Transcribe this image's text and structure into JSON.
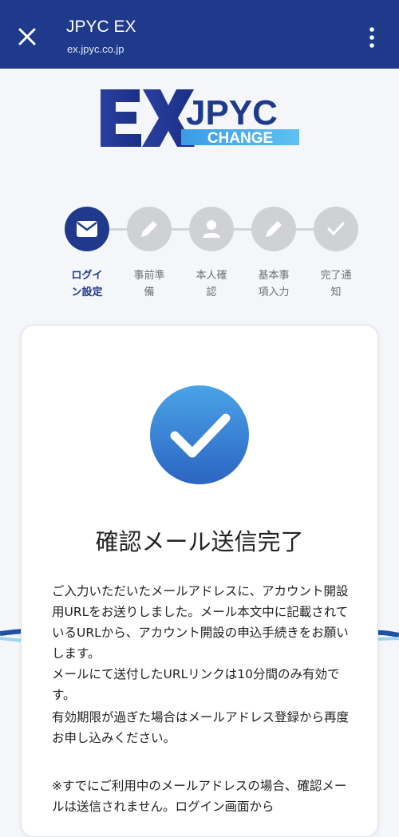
{
  "header": {
    "title": "JPYC EX",
    "url": "ex.jpyc.co.jp"
  },
  "logo": {
    "ex_text": "EX",
    "jpyc_text": "JPYC",
    "change_text": "CHANGE"
  },
  "steps": [
    {
      "label": "ログイン設定",
      "icon": "mail-icon",
      "active": true
    },
    {
      "label": "事前準備",
      "icon": "pencil-icon",
      "active": false
    },
    {
      "label": "本人確認",
      "icon": "person-icon",
      "active": false
    },
    {
      "label": "基本事項入力",
      "icon": "pencil-icon",
      "active": false
    },
    {
      "label": "完了通知",
      "icon": "check-icon",
      "active": false
    }
  ],
  "card": {
    "title": "確認メール送信完了",
    "message1": "ご入力いただいたメールアドレスに、アカウント開設用URLをお送りしました。メール本文中に記載されているURLから、アカウント開設の申込手続きをお願いします。",
    "message2": "メールにて送付したURLリンクは10分間のみ有効です。",
    "message3": "有効期限が過ぎた場合はメールアドレス登録から再度お申し込みください。",
    "message4": "※すでにご利用中のメールアドレスの場合、確認メールは送信されません。ログイン画面から"
  },
  "colors": {
    "header_bg": "#1f3a8a",
    "active_step": "#1f3a8a",
    "inactive_step": "#cfd1d5",
    "check_blue": "#3a7fd6"
  }
}
